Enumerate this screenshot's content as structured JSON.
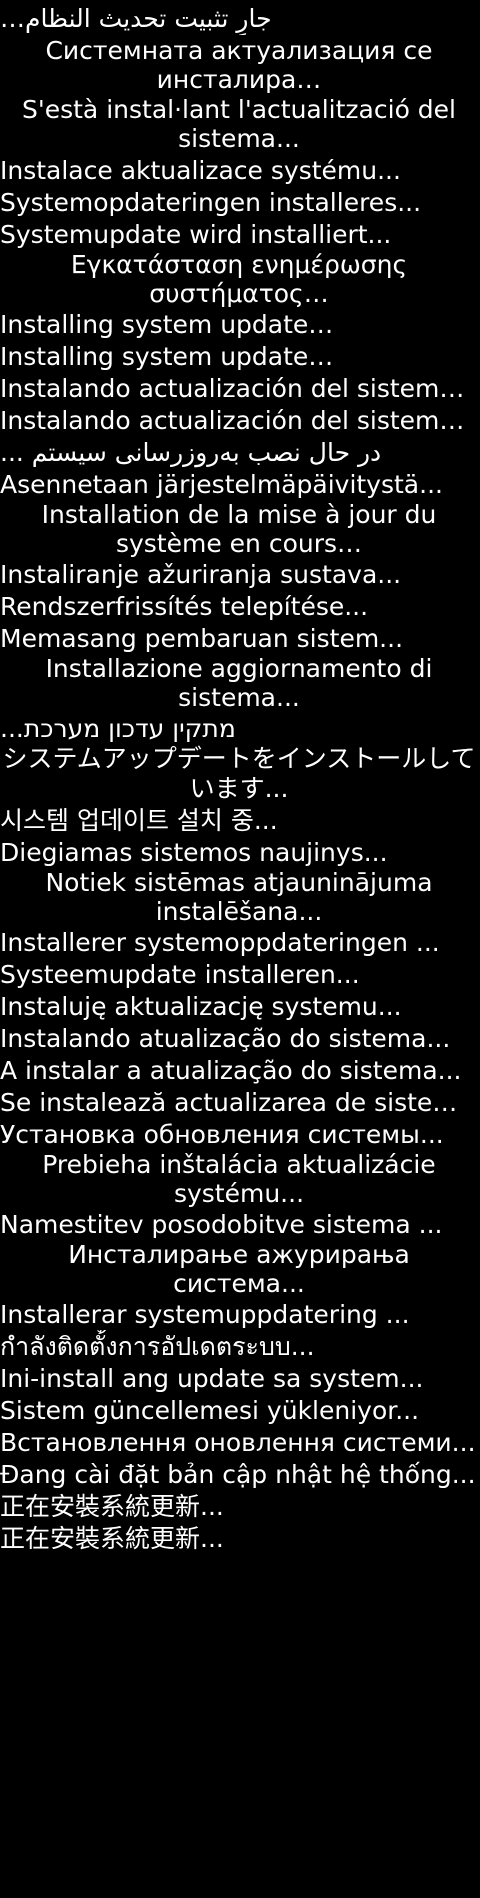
{
  "screen": {
    "background": "#000000",
    "text_color": "#ffffff"
  },
  "messages": [
    "جارٍ تثبيت تحديث النظام…",
    "Системната актуализация се инсталира…",
    "S'està instal·lant l'actualització del sistema...",
    "Instalace aktualizace systému...",
    "Systemopdateringen installeres...",
    "Systemupdate wird installiert...",
    "Εγκατάσταση ενημέρωσης συστήματος…",
    "Installing system update…",
    "Installing system update…",
    "Instalando actualización del sistema...",
    "Instalando actualización del sistema...",
    "در حال نصب به‌روزرسانی سیستم ...",
    "Asennetaan järjestelmäpäivitystä...",
    "Installation de la mise à jour du système en cours…",
    "Instaliranje ažuriranja sustava...",
    "Rendszerfrissítés telepítése...",
    "Memasang pembaruan sistem...",
    "Installazione aggiornamento di sistema...",
    "מתקין עדכון מערכת...",
    "システムアップデートをインストールしています...",
    "시스템 업데이트 설치 중...",
    "Diegiamas sistemos naujinys...",
    "Notiek sistēmas atjauninājuma instalēšana...",
    "Installerer systemoppdateringen ...",
    "Systeemupdate installeren...",
    "Instaluję aktualizację systemu...",
    "Instalando atualização do sistema...",
    "A instalar a atualização do sistema...",
    "Se instalează actualizarea de sistem...",
    "Установка обновления системы...",
    "Prebieha inštalácia aktualizácie systému...",
    "Namestitev posodobitve sistema ...",
    "Инсталирање ажурирања система...",
    "Installerar systemuppdatering ...",
    "กำลังติดตั้งการอัปเดตระบบ...",
    "Ini-install ang update sa system...",
    "Sistem güncellemesi yükleniyor...",
    "Встановлення оновлення системи...",
    "Đang cài đặt bản cập nhật hệ thống...",
    "正在安裝系統更新...",
    "正在安裝系統更新..."
  ]
}
